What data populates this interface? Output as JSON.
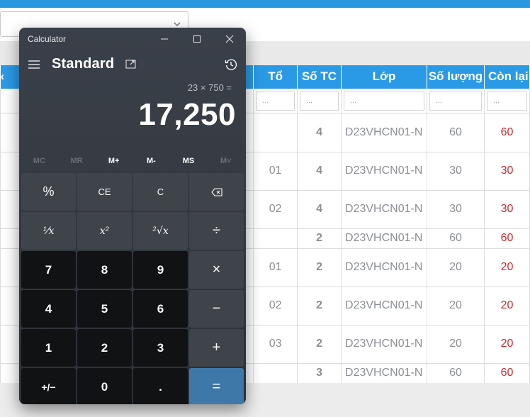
{
  "calculator": {
    "app_title": "Calculator",
    "mode": "Standard",
    "expression": "23 × 750 =",
    "result": "17,250",
    "memory": [
      {
        "label": "MC",
        "enabled": false
      },
      {
        "label": "MR",
        "enabled": false
      },
      {
        "label": "M+",
        "enabled": true
      },
      {
        "label": "M-",
        "enabled": true
      },
      {
        "label": "MS",
        "enabled": true
      },
      {
        "label": "M˅",
        "enabled": false
      }
    ],
    "keys": {
      "percent": "%",
      "ce": "CE",
      "c": "C",
      "backspace": "⌫",
      "reciprocal": "¹⁄x",
      "square": "x²",
      "sqrt": "²√x",
      "divide": "÷",
      "seven": "7",
      "eight": "8",
      "nine": "9",
      "multiply": "×",
      "four": "4",
      "five": "5",
      "six": "6",
      "minus": "−",
      "one": "1",
      "two": "2",
      "three": "3",
      "plus": "+",
      "negate": "+/−",
      "zero": "0",
      "decimal": ".",
      "equals": "="
    }
  },
  "table": {
    "columns": {
      "to": "Tổ",
      "sotc": "Số TC",
      "lop": "Lớp",
      "soluong": "Số lượng",
      "conlai": "Còn lại"
    },
    "filter_placeholder": "...",
    "rows": [
      {
        "to": "",
        "sotc": "4",
        "lop": "D23VHCN01-N",
        "soluong": "60",
        "conlai": "60"
      },
      {
        "to": "01",
        "sotc": "4",
        "lop": "D23VHCN01-N",
        "soluong": "30",
        "conlai": "30"
      },
      {
        "to": "02",
        "sotc": "4",
        "lop": "D23VHCN01-N",
        "soluong": "30",
        "conlai": "30"
      },
      {
        "to": "",
        "sotc": "2",
        "lop": "D23VHCN01-N",
        "soluong": "60",
        "conlai": "60"
      },
      {
        "to": "01",
        "sotc": "2",
        "lop": "D23VHCN01-N",
        "soluong": "20",
        "conlai": "20"
      },
      {
        "to": "02",
        "sotc": "2",
        "lop": "D23VHCN01-N",
        "soluong": "20",
        "conlai": "20"
      },
      {
        "to": "03",
        "sotc": "2",
        "lop": "D23VHCN01-N",
        "soluong": "20",
        "conlai": "20"
      },
      {
        "to": "",
        "sotc": "3",
        "lop": "D23VHCN01-N",
        "soluong": "60",
        "conlai": "60"
      }
    ]
  },
  "colors": {
    "header_blue": "#2b9ae6",
    "remaining_red": "#d0262d",
    "equals_blue": "#3e78a9"
  }
}
